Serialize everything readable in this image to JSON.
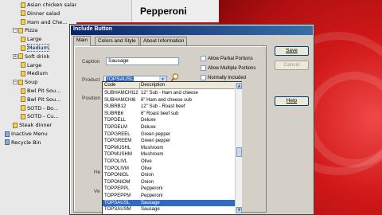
{
  "tree": {
    "items": [
      {
        "label": "Asian chicken salad",
        "indent": 2,
        "kind": "item"
      },
      {
        "label": "Dinner salad",
        "indent": 2,
        "kind": "item"
      },
      {
        "label": "Ham and Che...",
        "indent": 2,
        "kind": "item"
      },
      {
        "label": "Pizza",
        "indent": 1,
        "kind": "folder",
        "expander": "−"
      },
      {
        "label": "Large",
        "indent": 2,
        "kind": "item"
      },
      {
        "label": "Medium",
        "indent": 2,
        "kind": "item",
        "selected": true
      },
      {
        "label": "Soft drink",
        "indent": 1,
        "kind": "folder",
        "expander": "+"
      },
      {
        "label": "Large",
        "indent": 2,
        "kind": "item"
      },
      {
        "label": "Medium",
        "indent": 2,
        "kind": "item"
      },
      {
        "label": "Soup",
        "indent": 1,
        "kind": "folder",
        "expander": "−"
      },
      {
        "label": "Bwl Pit Sou...",
        "indent": 2,
        "kind": "item"
      },
      {
        "label": "Bwl Pit Sou...",
        "indent": 2,
        "kind": "item"
      },
      {
        "label": "SOTD - Bo...",
        "indent": 2,
        "kind": "item"
      },
      {
        "label": "SOTD - Cu...",
        "indent": 2,
        "kind": "item"
      },
      {
        "label": "Steak dinner",
        "indent": 1,
        "kind": "item"
      },
      {
        "label": "Inactive Menu",
        "indent": 0,
        "kind": "sys"
      },
      {
        "label": "Recycle Bin",
        "indent": 0,
        "kind": "sys"
      }
    ]
  },
  "preview": {
    "title": "Pepperoni"
  },
  "dialog": {
    "title": "Include Button",
    "tabs": [
      "Main",
      "Colors and Style",
      "About Information"
    ],
    "caption_label": "Caption",
    "caption_value": "Sausage",
    "product_label": "Product",
    "product_value": "TOPSAUSL",
    "position_label": "Position",
    "he_label": "He",
    "ve_label": "Ve",
    "options": [
      "Allow Partial Portions",
      "Allow Multiple Portions",
      "Normally Included"
    ],
    "buttons": [
      "Save",
      "Cancel",
      "Help"
    ]
  },
  "dropdown": {
    "columns": [
      "Code",
      "Description"
    ],
    "rows": [
      [
        "SUBHAMCHI12",
        "12\" Sub - Ham and cheese"
      ],
      [
        "SUBHAMCHI6",
        "6\" Ham and cheese sub"
      ],
      [
        "SUBRB12",
        "12\" Sub - Roast beef"
      ],
      [
        "SUBRB6",
        "6\" Roast beef sub"
      ],
      [
        "TOPDELL",
        "Deluxe"
      ],
      [
        "TOPDELM",
        "Deluxe"
      ],
      [
        "TOPGREEL",
        "Green pepper"
      ],
      [
        "TOPGREEM",
        "Green pepper"
      ],
      [
        "TOPMUSHL",
        "Mushroom"
      ],
      [
        "TOPMUSHM",
        "Mushroom"
      ],
      [
        "TOPOLIVL",
        "Olive"
      ],
      [
        "TOPOLIVM",
        "Olive"
      ],
      [
        "TOPONIOL",
        "Onion"
      ],
      [
        "TOPONIOM",
        "Onion"
      ],
      [
        "TOPPEPPL",
        "Pepperoni"
      ],
      [
        "TOPPEPPM",
        "Pepperoni"
      ],
      [
        "TOPSAUSL",
        "Sausage"
      ],
      [
        "TOPSAUSM",
        "Sausage"
      ]
    ],
    "selected_index": 16
  }
}
